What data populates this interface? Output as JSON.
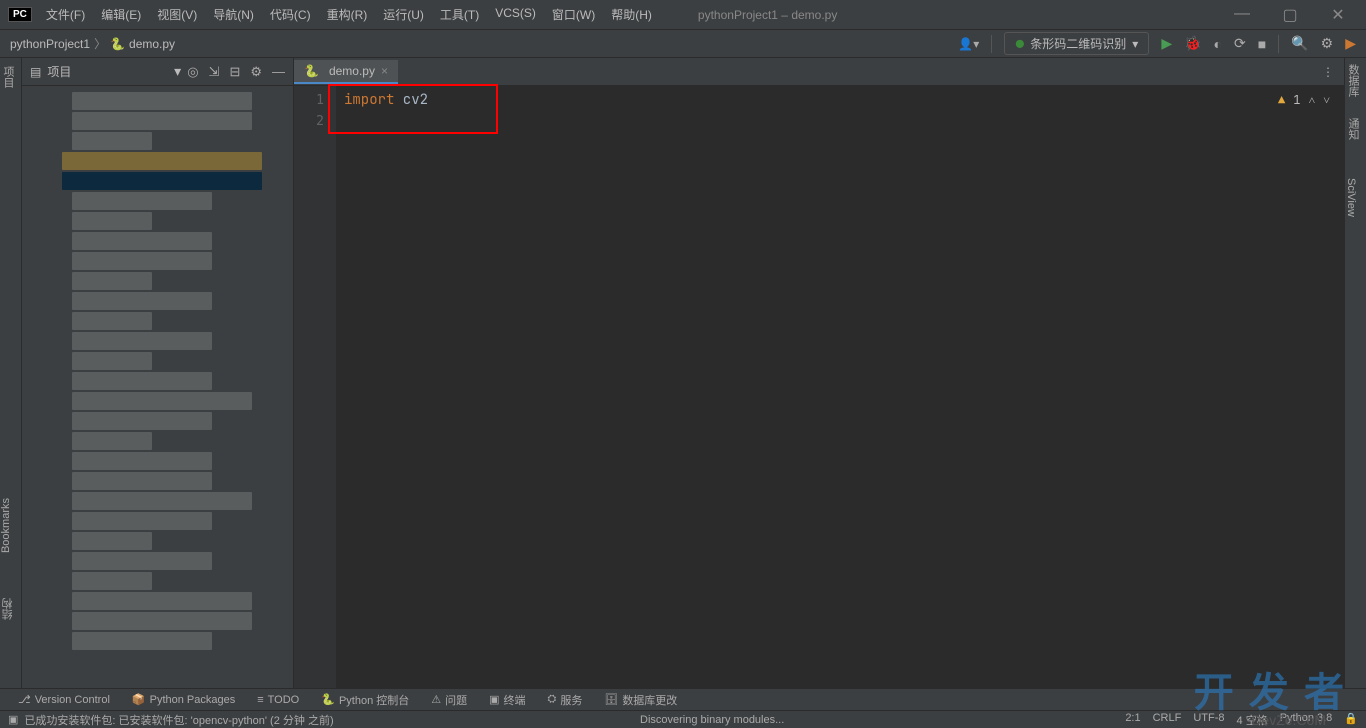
{
  "window": {
    "badge": "PC",
    "title": "pythonProject1 – demo.py"
  },
  "menu": [
    "文件(F)",
    "编辑(E)",
    "视图(V)",
    "导航(N)",
    "代码(C)",
    "重构(R)",
    "运行(U)",
    "工具(T)",
    "VCS(S)",
    "窗口(W)",
    "帮助(H)"
  ],
  "breadcrumb": {
    "project": "pythonProject1",
    "file": "demo.py"
  },
  "run_config": "条形码二维码识别",
  "project_pane": {
    "title": "项目"
  },
  "tab": {
    "label": "demo.py"
  },
  "editor": {
    "lines": [
      "1",
      "2"
    ],
    "code_kw": "import",
    "code_ident": " cv2",
    "warn_count": "1"
  },
  "left_labels": {
    "structure": "项目",
    "bookmarks": "Bookmarks",
    "jiegou": "结构"
  },
  "right_labels": {
    "notifications": "通知",
    "database": "数据库",
    "sciview": "SciView"
  },
  "bottom_tabs": {
    "version": "Version Control",
    "pypkg": "Python Packages",
    "todo": "TODO",
    "console": "Python 控制台",
    "problems": "问题",
    "terminal": "终端",
    "services": "服务",
    "dbchanges": "数据库更改"
  },
  "status": {
    "msg": "已成功安装软件包: 已安装软件包: 'opencv-python' (2 分钟 之前)",
    "discover": "Discovering binary modules...",
    "pos": "2:1",
    "crlf": "CRLF",
    "enc": "UTF-8",
    "spaces": "4 空格",
    "python": "Python 3.8"
  },
  "watermark": "开 发 者",
  "watermark2": "DevZe.CoM"
}
